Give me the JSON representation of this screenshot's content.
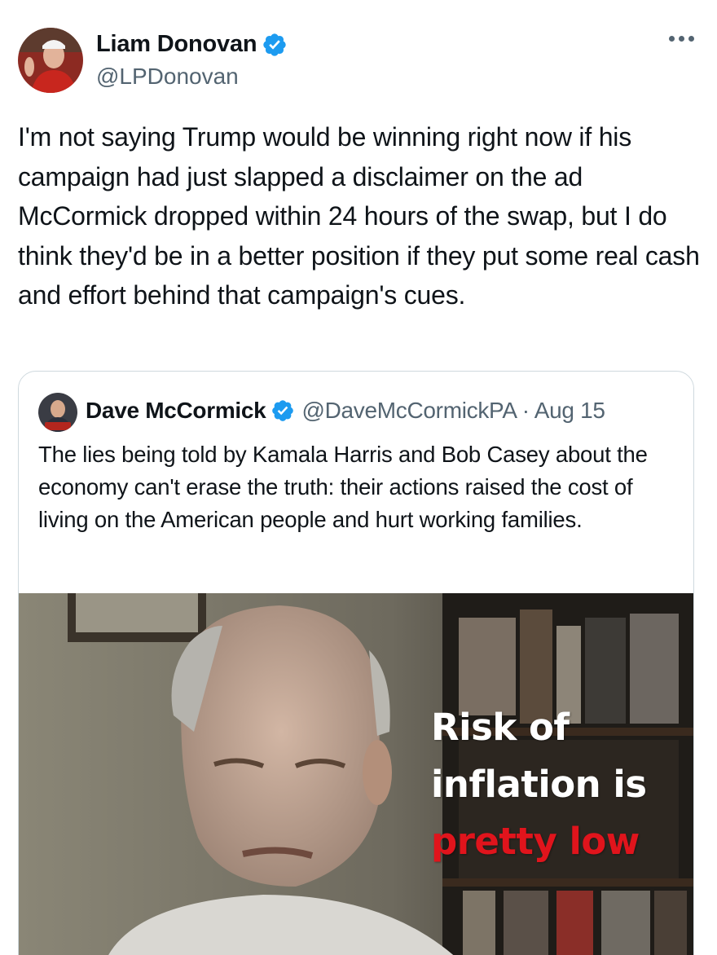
{
  "author": {
    "name": "Liam Donovan",
    "handle": "@LPDonovan",
    "verified": true,
    "avatar_icon": "user-avatar-photo"
  },
  "tweet": {
    "text": "I'm not saying Trump would be winning right now if his campaign had just slapped a disclaimer on the ad McCormick dropped within 24 hours of the swap, but I do think they'd be in a better position if they put some real cash and effort behind that campaign's cues."
  },
  "quote": {
    "name": "Dave McCormick",
    "handle": "@DaveMcCormickPA",
    "separator": "·",
    "date": "Aug 15",
    "verified": true,
    "text": "The lies being told by Kamala Harris and Bob Casey about the economy can't erase the truth: their actions raised the cost of living on the American people and hurt working families.",
    "media": {
      "overlay_line1": "Risk of",
      "overlay_line2": "inflation is",
      "overlay_line3": "pretty low"
    }
  },
  "colors": {
    "verified_blue": "#1d9bf0",
    "secondary_text": "#536471",
    "overlay_red": "#e0141c"
  },
  "icons": [
    "verified-badge-icon",
    "more-options-icon"
  ]
}
